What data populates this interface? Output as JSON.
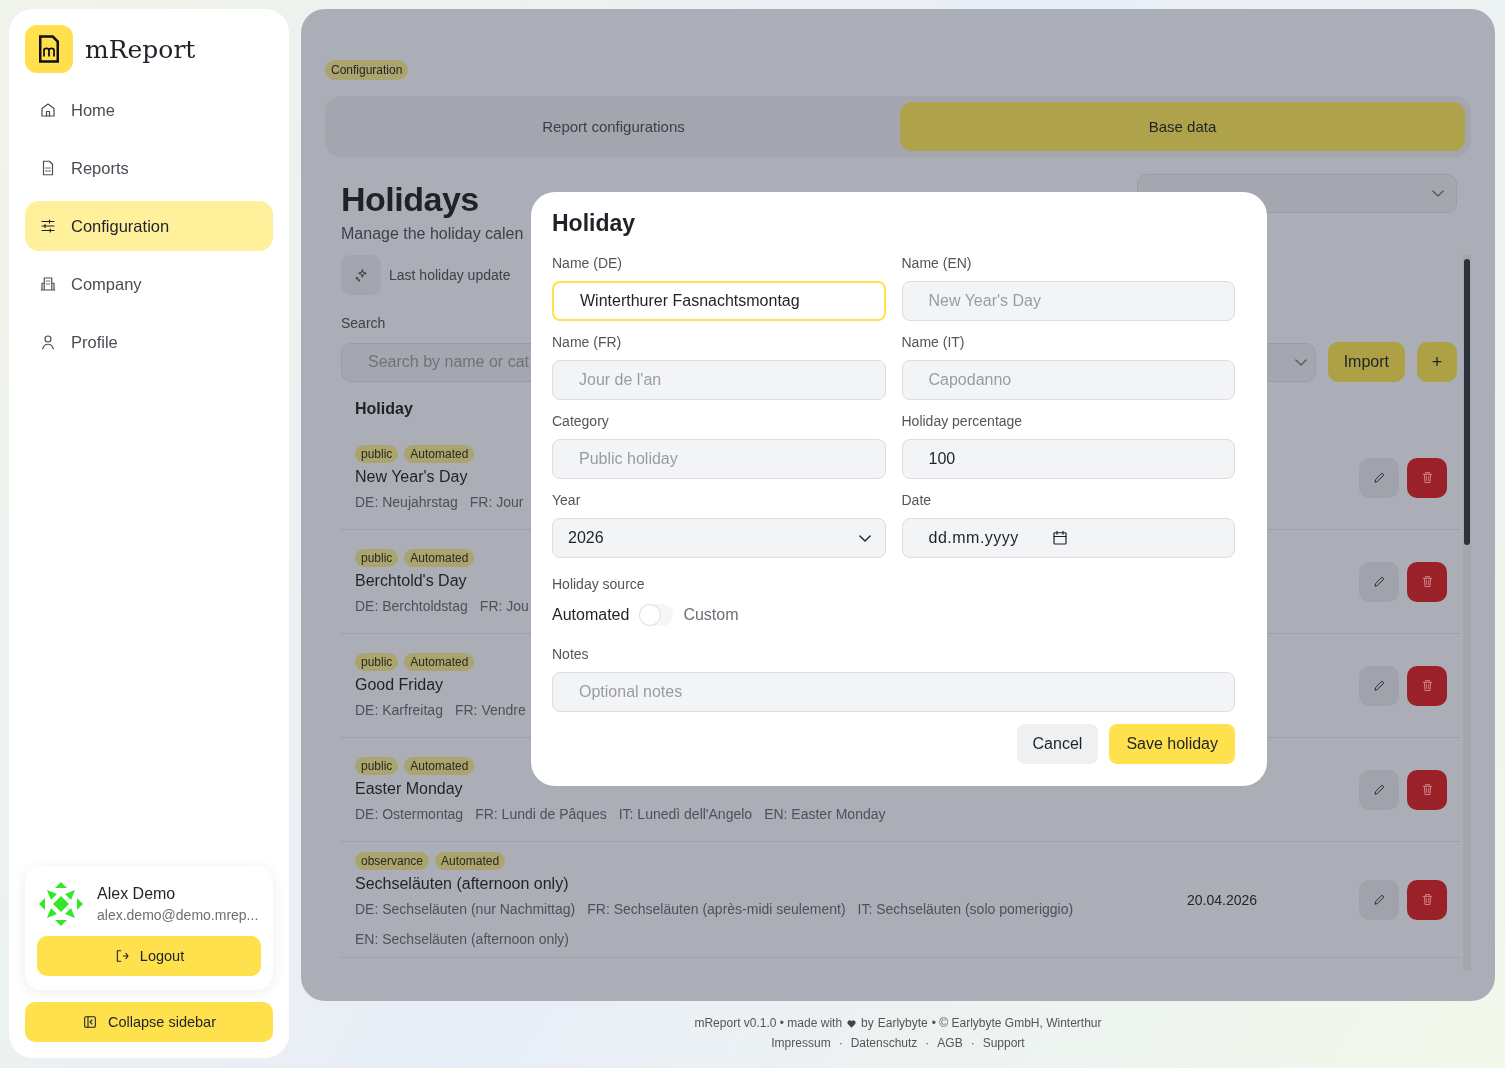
{
  "app": {
    "name": "mReport"
  },
  "nav": [
    {
      "label": "Home",
      "selected": false
    },
    {
      "label": "Reports",
      "selected": false
    },
    {
      "label": "Configuration",
      "selected": true
    },
    {
      "label": "Company",
      "selected": false
    },
    {
      "label": "Profile",
      "selected": false
    }
  ],
  "user": {
    "name": "Alex Demo",
    "email": "alex.demo@demo.mrep..."
  },
  "logout": "Logout",
  "collapse": "Collapse sidebar",
  "breadcrumb": "Configuration",
  "tabs": [
    {
      "label": "Report configurations",
      "selected": false
    },
    {
      "label": "Base data",
      "selected": true
    }
  ],
  "page": {
    "title": "Holidays",
    "subtitle": "Manage the holiday calen",
    "last_update": "Last holiday update"
  },
  "search": {
    "label": "Search",
    "placeholder": "Search by name or cat"
  },
  "import": "Import",
  "add": "+",
  "table": {
    "column_1": "Holiday",
    "rows": [
      {
        "tags": [
          "public",
          "Automated"
        ],
        "name": "New Year's Day",
        "details": [
          "DE: Neujahrstag",
          "FR: Jour"
        ]
      },
      {
        "tags": [
          "public",
          "Automated"
        ],
        "name": "Berchtold's Day",
        "details": [
          "DE: Berchtoldstag",
          "FR: Jou"
        ]
      },
      {
        "tags": [
          "public",
          "Automated"
        ],
        "name": "Good Friday",
        "details": [
          "DE: Karfreitag",
          "FR: Vendre"
        ]
      },
      {
        "tags": [
          "public",
          "Automated"
        ],
        "name": "Easter Monday",
        "details": [
          "DE: Ostermontag",
          "FR: Lundi de Pâques",
          "IT: Lunedì dell'Angelo",
          "EN: Easter Monday"
        ]
      },
      {
        "tags": [
          "observance",
          "Automated"
        ],
        "name": "Sechseläuten (afternoon only)",
        "details": [
          "DE: Sechseläuten (nur Nachmittag)",
          "FR: Sechseläuten (après-midi seulement)",
          "IT: Sechseläuten (solo pomeriggio)",
          "EN: Sechseläuten (afternoon only)"
        ],
        "date": "20.04.2026"
      }
    ]
  },
  "modal": {
    "title": "Holiday",
    "fields": [
      {
        "kind": "text",
        "label": "Name (DE)",
        "value": "Winterthurer Fasnachtsmontag",
        "focused": true
      },
      {
        "kind": "text",
        "label": "Name (EN)",
        "placeholder": "New Year's Day",
        "focused": false
      },
      {
        "kind": "text",
        "label": "Name (FR)",
        "placeholder": "Jour de l'an",
        "focused": false
      },
      {
        "kind": "text",
        "label": "Name (IT)",
        "placeholder": "Capodanno",
        "focused": false
      },
      {
        "kind": "text",
        "label": "Category",
        "placeholder": "Public holiday",
        "focused": false
      },
      {
        "kind": "text",
        "label": "Holiday percentage",
        "value": "100",
        "focused": false
      },
      {
        "kind": "select",
        "label": "Year",
        "value": "2026",
        "focused": false
      },
      {
        "kind": "date",
        "label": "Date",
        "value": "dd.mm.yyyy",
        "focused": false
      }
    ],
    "source": {
      "label": "Holiday source",
      "left": "Automated",
      "right": "Custom",
      "on": false
    },
    "notes": {
      "label": "Notes",
      "placeholder": "Optional notes"
    },
    "cancel": "Cancel",
    "save": "Save holiday"
  },
  "footer": {
    "line_start": "mReport v0.1.0 • made with",
    "by": "by",
    "link": "Earlybyte",
    "line_end": "• © Earlybyte GmbH, Winterthur",
    "links": [
      "Impressum",
      "Datenschutz",
      "AGB",
      "Support"
    ],
    "separator": "·"
  }
}
